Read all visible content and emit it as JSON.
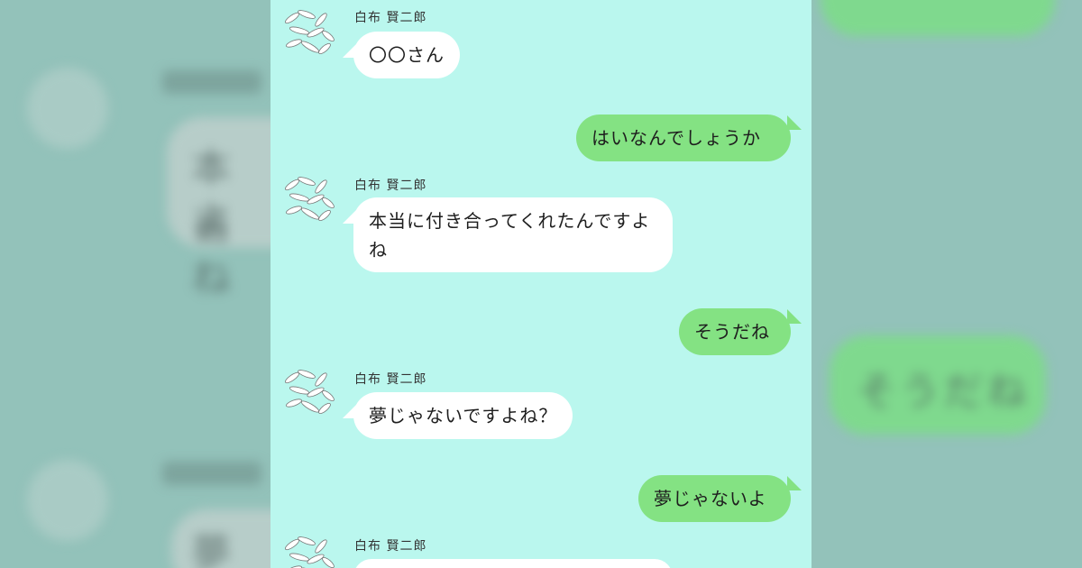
{
  "chat": {
    "messages": [
      {
        "sender": "白布 賢二郎",
        "text": "〇〇さん",
        "direction": "incoming"
      },
      {
        "text": "はいなんでしょうか",
        "direction": "outgoing"
      },
      {
        "sender": "白布 賢二郎",
        "text": "本当に付き合ってくれたんですよね",
        "direction": "incoming"
      },
      {
        "text": "そうだね",
        "direction": "outgoing"
      },
      {
        "sender": "白布 賢二郎",
        "text": "夢じゃないですよね？",
        "direction": "incoming"
      },
      {
        "text": "夢じゃないよ",
        "direction": "outgoing"
      },
      {
        "sender": "白布 賢二郎",
        "text": "",
        "direction": "incoming"
      }
    ]
  },
  "colors": {
    "chat_background": "#baf7ee",
    "incoming_bubble": "#ffffff",
    "outgoing_bubble": "#84e283",
    "side_backdrop": "#8fbeb6"
  },
  "icons": {
    "avatar": "fish-sketch-avatar-icon"
  }
}
